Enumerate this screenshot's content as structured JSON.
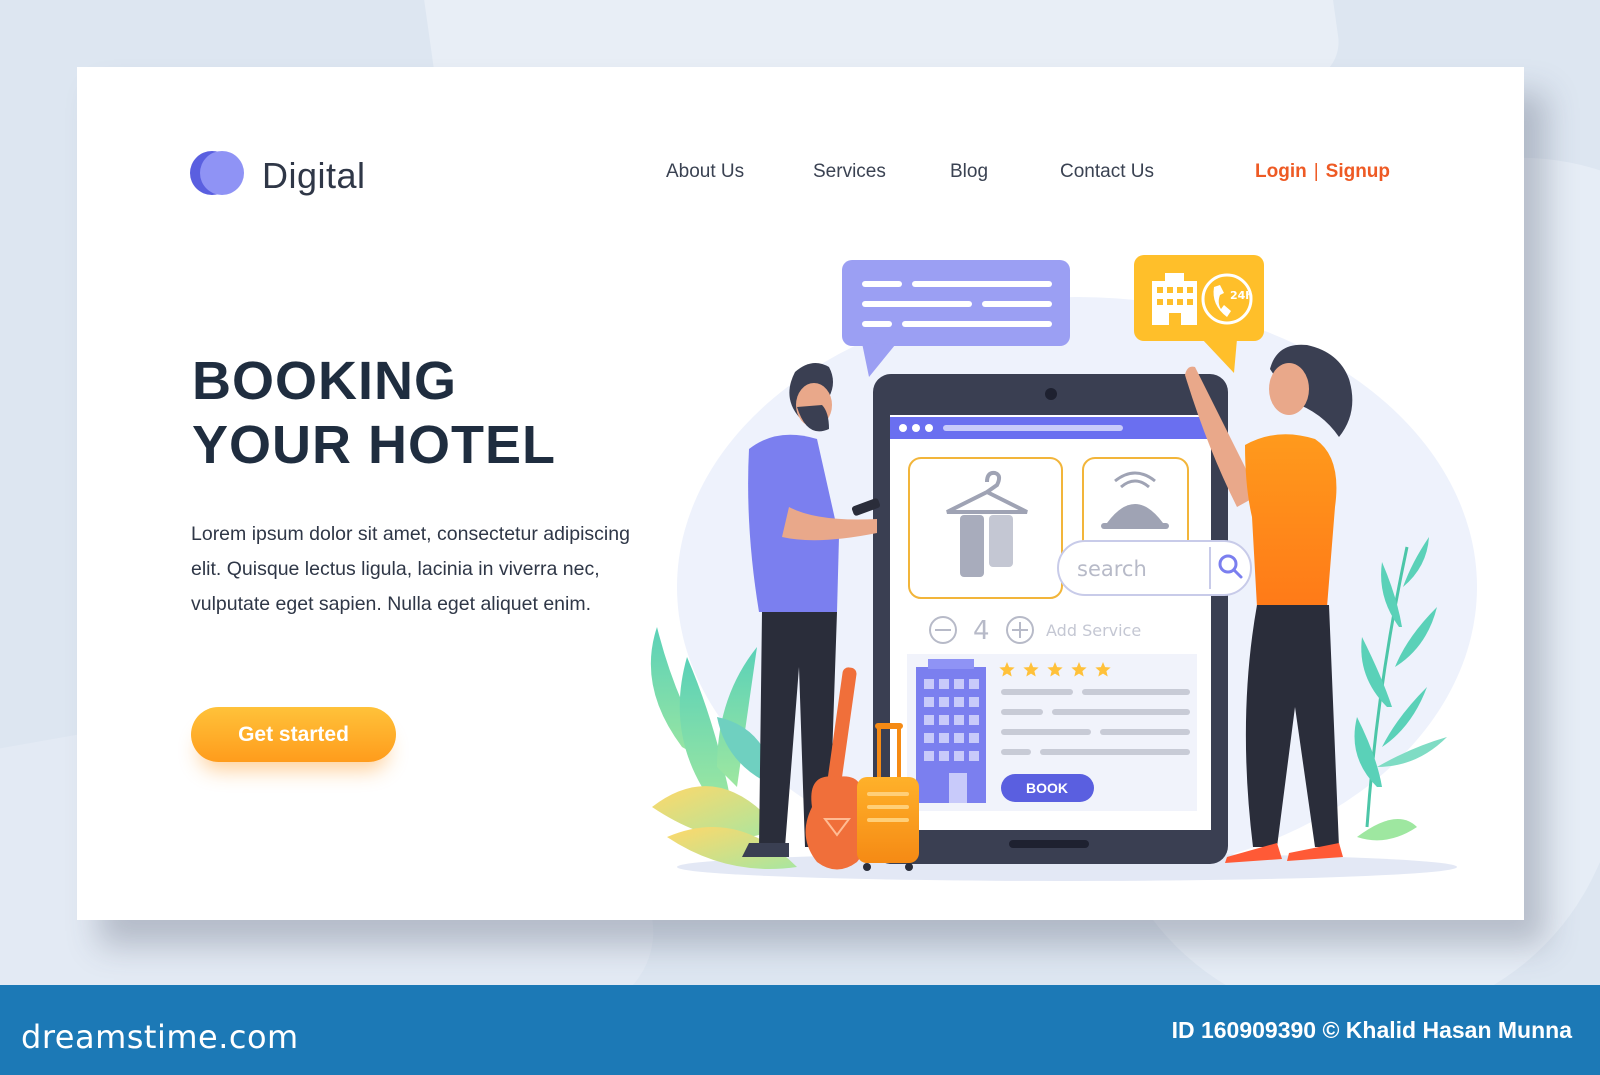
{
  "header": {
    "logo_text": "Digital",
    "nav": [
      "About Us",
      "Services",
      "Blog",
      "Contact Us"
    ],
    "login": "Login",
    "separator": "|",
    "signup": "Signup"
  },
  "hero": {
    "title_line1": "BOOKING",
    "title_line2": "YOUR HOTEL",
    "body": "Lorem ipsum dolor sit amet, consectetur adipiscing elit. Quisque lectus ligula, lacinia in viverra nec, vulputate eget sapien. Nulla eget aliquet enim.",
    "cta": "Get started"
  },
  "tablet": {
    "search_placeholder": "search",
    "quantity": "4",
    "add_service": "Add Service",
    "book_label": "BOOK",
    "rating_stars": 5,
    "badge_24h": "24h"
  },
  "watermark": {
    "site": "dreamstime.com",
    "credit": "ID 160909390 © Khalid Hasan Munna"
  },
  "colors": {
    "accent_orange": "#ee5a24",
    "cta_orange": "#ff9c1c",
    "brand_purple": "#7b7fef",
    "heading": "#1f2d3f",
    "banner_blue": "#1c79b6"
  }
}
